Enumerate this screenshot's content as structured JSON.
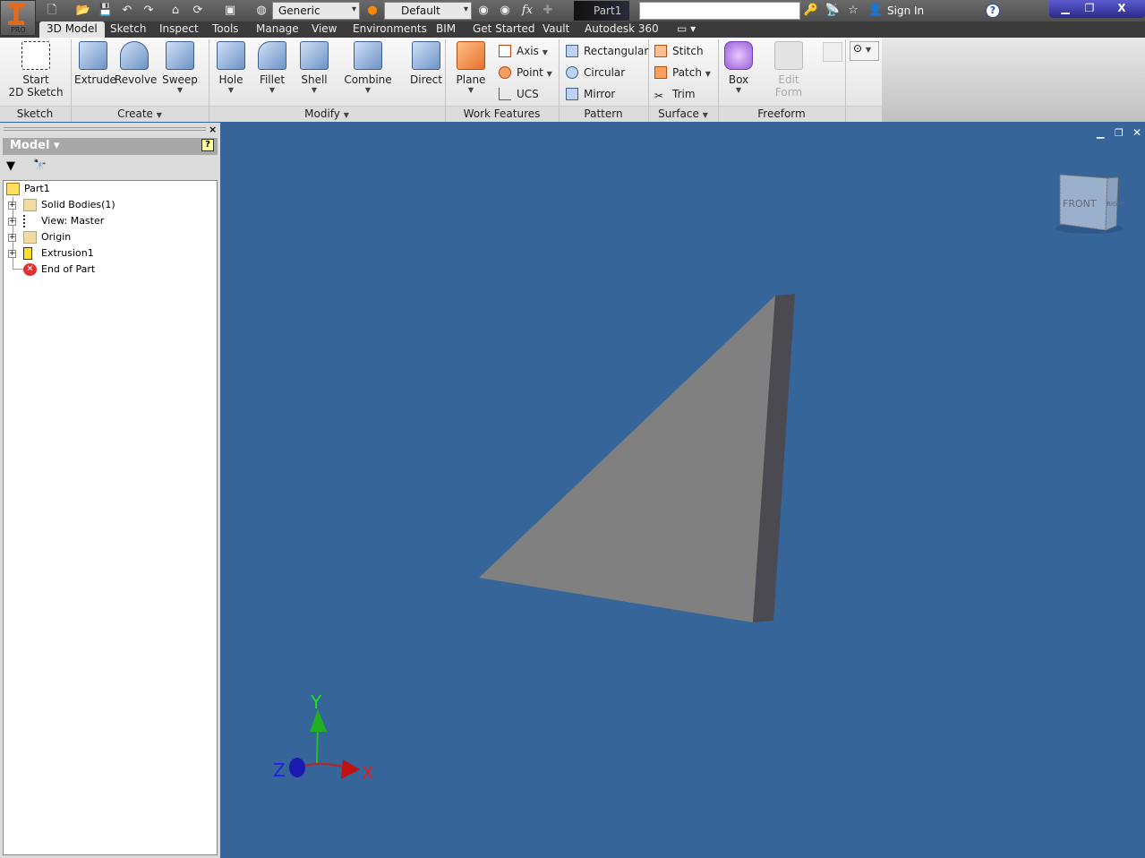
{
  "app": {
    "edition": "PRO",
    "document_title": "Part1",
    "search_placeholder": "",
    "sign_in": "Sign In",
    "help": "?"
  },
  "quick_access": {
    "material": "Generic",
    "appearance": "Default",
    "fx": "fx"
  },
  "tabs": [
    {
      "label": "3D Model",
      "active": true
    },
    {
      "label": "Sketch"
    },
    {
      "label": "Inspect"
    },
    {
      "label": "Tools"
    },
    {
      "label": "Manage"
    },
    {
      "label": "View"
    },
    {
      "label": "Environments"
    },
    {
      "label": "BIM"
    },
    {
      "label": "Get Started"
    },
    {
      "label": "Vault"
    },
    {
      "label": "Autodesk 360"
    }
  ],
  "ribbon": {
    "sketch": {
      "label": "Sketch",
      "start_line1": "Start",
      "start_line2": "2D Sketch"
    },
    "create": {
      "label": "Create",
      "extrude": "Extrude",
      "revolve": "Revolve",
      "sweep": "Sweep"
    },
    "modify": {
      "label": "Modify",
      "hole": "Hole",
      "fillet": "Fillet",
      "shell": "Shell",
      "combine": "Combine",
      "direct": "Direct"
    },
    "work_features": {
      "label": "Work Features",
      "plane": "Plane",
      "axis": "Axis",
      "point": "Point",
      "ucs": "UCS"
    },
    "pattern": {
      "label": "Pattern",
      "rectangular": "Rectangular",
      "circular": "Circular",
      "mirror": "Mirror"
    },
    "surface": {
      "label": "Surface",
      "stitch": "Stitch",
      "patch": "Patch",
      "trim": "Trim"
    },
    "freeform": {
      "label": "Freeform",
      "box": "Box",
      "edit_line1": "Edit",
      "edit_line2": "Form"
    }
  },
  "browser": {
    "title": "Model",
    "tree": [
      {
        "label": "Part1"
      },
      {
        "label": "Solid Bodies(1)"
      },
      {
        "label": "View: Master"
      },
      {
        "label": "Origin"
      },
      {
        "label": "Extrusion1"
      },
      {
        "label": "End of Part"
      }
    ]
  },
  "viewcube": {
    "front": "FRONT",
    "right": "RIGHT"
  },
  "triad": {
    "x": "X",
    "y": "Y",
    "z": "Z"
  },
  "colors": {
    "viewport": "#36659a",
    "model_face": "#808080",
    "model_side": "#4a4a50",
    "x_axis": "#e02020",
    "y_axis": "#20c020",
    "z_axis": "#2020e0"
  }
}
